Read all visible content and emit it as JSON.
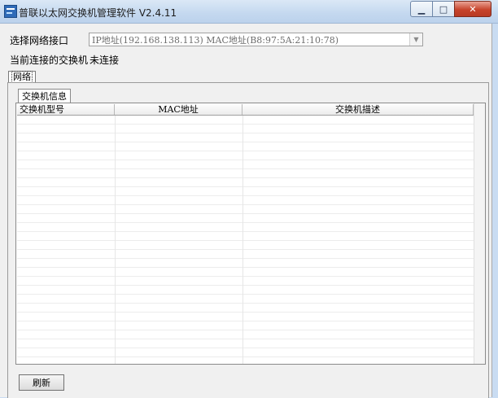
{
  "window": {
    "title": "普联以太网交换机管理软件 V2.4.11",
    "controls": {
      "minimize_icon": "minimize-icon",
      "maximize_icon": "maximize-icon",
      "close_icon": "close-icon"
    }
  },
  "form": {
    "interface_label": "选择网络接口",
    "interface_value": "IP地址(192.168.138.113)   MAC地址(B8:97:5A:21:10:78)",
    "connected_label": "当前连接的交换机",
    "connected_value": "未连接"
  },
  "tabs": {
    "outer": "网络",
    "inner": "交换机信息"
  },
  "table": {
    "columns": [
      "交换机型号",
      "MAC地址",
      "交换机描述"
    ],
    "rows": []
  },
  "buttons": {
    "refresh": "刷新"
  },
  "colors": {
    "titlebar": "#c4d8ef",
    "close_button": "#c7442c",
    "client_bg": "#f0f0f0"
  }
}
